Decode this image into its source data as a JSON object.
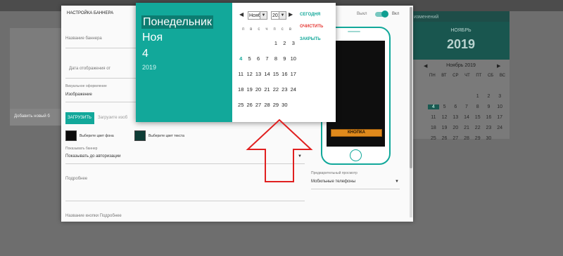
{
  "background": {
    "left_add_text": "Добавить новый б",
    "right_top_text": "изменений",
    "right_month": "НОЯБРЬ",
    "right_year": "2019",
    "right_cal_title": "Ноябрь 2019",
    "right_prev": "◀",
    "right_next": "▶",
    "right_weekdays": [
      "ПН",
      "ВТ",
      "СР",
      "ЧТ",
      "ПТ",
      "СБ",
      "ВС"
    ],
    "right_days": [
      "",
      "",
      "",
      "",
      "1",
      "2",
      "3",
      "4",
      "5",
      "6",
      "7",
      "8",
      "9",
      "10",
      "11",
      "12",
      "13",
      "14",
      "15",
      "16",
      "17",
      "18",
      "19",
      "20",
      "21",
      "22",
      "23",
      "24",
      "25",
      "26",
      "27",
      "28",
      "29",
      "30",
      ""
    ],
    "right_selected_day": "4"
  },
  "modal": {
    "title": "НАСТРОЙКА БАННЕРА",
    "toggle_off_label": "Выкл",
    "toggle_on_label": "Вкл",
    "toggle_on": true,
    "banner_name_label": "Название баннера",
    "display_date_label": "Дата отображения от",
    "visual_label": "Визуальное оформление",
    "visual_value": "Изображение",
    "upload_button": "ЗАГРУЗИТЬ",
    "upload_file_name": "Загрузите изоб",
    "bg_color_label": "Выберите цвет фона",
    "text_color_label": "Выберите цвет текста",
    "bg_color": "#0b0b0b",
    "text_color": "#0e3d36",
    "show_banner_label": "Показывать баннер",
    "show_banner_value": "Показывать до авторизации",
    "more_label": "Подробнее",
    "more_button_label": "Название кнопки Подробнее",
    "preview_label": "Предварительный просмотр",
    "preview_value": "Мобильные телефоны",
    "phone_button": "КНОПКА"
  },
  "picker": {
    "weekday": "Понедельник",
    "month": "Ноя",
    "day": "4",
    "year": "2019",
    "prev": "◀",
    "next": "▶",
    "month_select": "Нояб",
    "year_select": "2019",
    "dropdown_glyph": "▼",
    "today_label": "Сегодня",
    "clear_label": "Очистить",
    "close_label": "Закрыть",
    "weekdays": [
      "п",
      "в",
      "с",
      "ч",
      "п",
      "с",
      "в"
    ],
    "days": [
      "",
      "",
      "",
      "",
      "1",
      "2",
      "3",
      "4",
      "5",
      "6",
      "7",
      "8",
      "9",
      "10",
      "11",
      "12",
      "13",
      "14",
      "15",
      "16",
      "17",
      "18",
      "19",
      "20",
      "21",
      "22",
      "23",
      "24",
      "25",
      "26",
      "27",
      "28",
      "29",
      "30"
    ],
    "today_day": "4"
  },
  "colors": {
    "accent": "#12a89a",
    "danger": "#e53935",
    "arrow": "#e02020"
  }
}
